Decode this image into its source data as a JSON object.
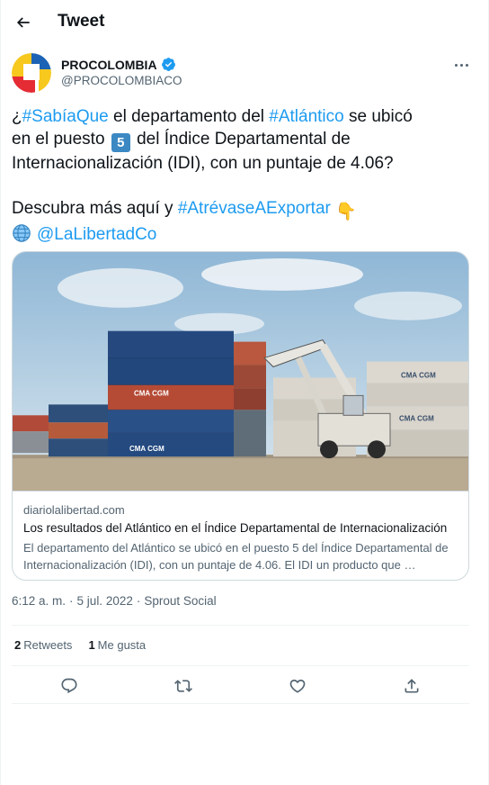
{
  "header": {
    "title": "Tweet",
    "back_icon": "arrow-left-icon"
  },
  "author": {
    "name": "PROCOLOMBIA",
    "handle": "@PROCOLOMBIACO",
    "verified": true,
    "verified_color": "#1d9bf0"
  },
  "tweet": {
    "line1": {
      "pre": "¿",
      "hashtag1": "#SabíaQue",
      "mid": " el departamento del ",
      "hashtag2": "#Atlántico",
      "post": " se ubicó"
    },
    "line2": {
      "pre": "en el puesto ",
      "keycap": "5",
      "post": " del Índice Departamental de"
    },
    "line3": "Internacionalización (IDI), con un puntaje de 4.06?",
    "line4": {
      "pre": "Descubra más aquí y ",
      "hashtag": "#AtrévaseAExportar",
      "emoji": "👇"
    },
    "line5": {
      "mention": "@LaLibertadCo",
      "emoji_icon": "globe-icon"
    },
    "link_color": "#1d9bf0"
  },
  "card": {
    "domain": "diariolalibertad.com",
    "title": "Los resultados del Atlántico en el Índice Departamental de Internacionalización",
    "description": "El departamento del Atlántico se ubicó en el puesto 5 del Índice Departamental de Internacionalización (IDI), con un puntaje de 4.06. El IDI un producto que …",
    "image_text": {
      "container_brand": "CMA CGM"
    }
  },
  "meta": {
    "time": "6:12 a. m.",
    "separator": "·",
    "date": "5 jul. 2022",
    "source": "Sprout Social"
  },
  "stats": {
    "retweets_count": "2",
    "retweets_label": "Retweets",
    "likes_count": "1",
    "likes_label": "Me gusta"
  },
  "actions": [
    "reply-icon",
    "retweet-icon",
    "like-icon",
    "share-icon"
  ]
}
